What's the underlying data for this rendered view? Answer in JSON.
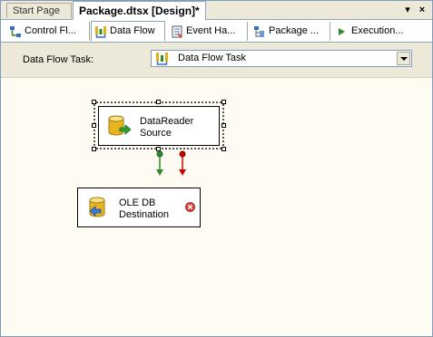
{
  "doc_tabs": [
    {
      "label": "Start Page"
    },
    {
      "label": "Package.dtsx [Design]*"
    }
  ],
  "window_buttons": {
    "dropdown": "▾",
    "close": "×"
  },
  "designer_tabs": [
    {
      "label": "Control Fl...",
      "icon": "control-flow-icon"
    },
    {
      "label": "Data Flow",
      "icon": "data-flow-icon"
    },
    {
      "label": "Event Ha...",
      "icon": "event-handlers-icon"
    },
    {
      "label": "Package ...",
      "icon": "package-explorer-icon"
    },
    {
      "label": "Execution...",
      "icon": "execution-results-icon"
    }
  ],
  "task_selector": {
    "label": "Data Flow Task:",
    "value": "Data Flow Task"
  },
  "components": {
    "source": {
      "line1": "DataReader",
      "line2": "Source"
    },
    "destination": {
      "line1": "OLE DB",
      "line2": "Destination"
    }
  },
  "colors": {
    "success_path": "#2e8b2e",
    "error_path": "#cc0000",
    "error_badge": "#d9463f"
  }
}
